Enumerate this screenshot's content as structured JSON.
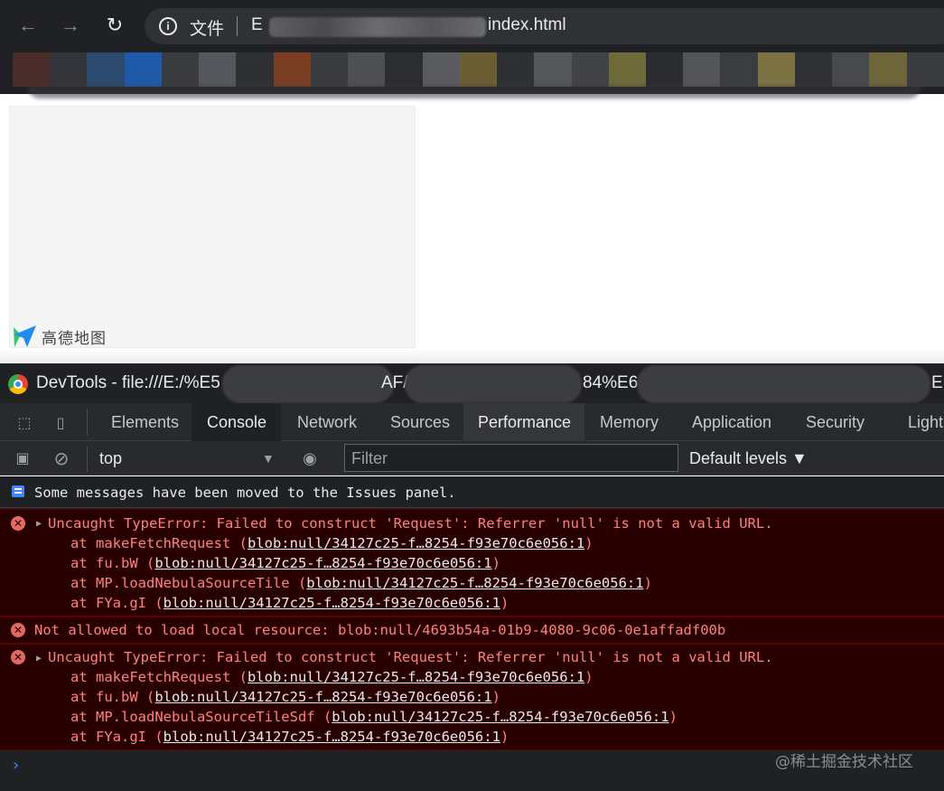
{
  "browser": {
    "back_icon": "←",
    "forward_icon": "→",
    "reload_icon": "↻",
    "info_icon": "i",
    "scheme_label": "文件",
    "url_prefix": "E",
    "url_suffix": "index.html",
    "bookmark_colors": [
      "#4a2c2a",
      "#34353a",
      "#2c4a6e",
      "#1f5aa8",
      "#3a3b3f",
      "#55575c",
      "#2f3033",
      "#7a3e22",
      "#3a3b3e",
      "#4f5053",
      "#2c2d30",
      "#5a5b5e",
      "#6b5e34",
      "#2f3033",
      "#55565a",
      "#424347",
      "#6e6a3a",
      "#2b2c2f",
      "#545559",
      "#3b3c3f",
      "#7d7243",
      "#303134",
      "#48494c",
      "#6e653a",
      "#3a3b3e"
    ]
  },
  "map": {
    "logo_text": "高德地图"
  },
  "devtools": {
    "title_prefix": "DevTools - file:///E:/%E5",
    "title_frag_1": "AF/",
    "title_frag_2": "84%E6",
    "title_frag_3": "E",
    "inspect_icon": "⬚",
    "device_icon": "▯",
    "tabs": {
      "elements": "Elements",
      "console": "Console",
      "network": "Network",
      "sources": "Sources",
      "performance": "Performance",
      "memory": "Memory",
      "application": "Application",
      "security": "Security",
      "lighthouse": "Light"
    },
    "toolbar": {
      "sidebar_icon": "▣",
      "clear_icon": "⊘",
      "context": "top",
      "context_arrow": "▼",
      "eye_icon": "◉",
      "filter_placeholder": "Filter",
      "levels": "Default levels ▼"
    }
  },
  "console": {
    "info_message": "Some messages have been moved to the Issues panel.",
    "error_icon": "✕",
    "error1": {
      "head": "Uncaught TypeError: Failed to construct 'Request': Referrer 'null' is not a valid URL.",
      "frames": [
        {
          "fn": "at makeFetchRequest (",
          "loc": "blob:null/34127c25-f…8254-f93e70c6e056:1",
          "end": ")"
        },
        {
          "fn": "at fu.bW (",
          "loc": "blob:null/34127c25-f…8254-f93e70c6e056:1",
          "end": ")"
        },
        {
          "fn": "at MP.loadNebulaSourceTile (",
          "loc": "blob:null/34127c25-f…8254-f93e70c6e056:1",
          "end": ")"
        },
        {
          "fn": "at FYa.gI (",
          "loc": "blob:null/34127c25-f…8254-f93e70c6e056:1",
          "end": ")"
        }
      ]
    },
    "error2": "Not allowed to load local resource: blob:null/4693b54a-01b9-4080-9c06-0e1affadf00b",
    "error3": {
      "head": "Uncaught TypeError: Failed to construct 'Request': Referrer 'null' is not a valid URL.",
      "frames": [
        {
          "fn": "at makeFetchRequest (",
          "loc": "blob:null/34127c25-f…8254-f93e70c6e056:1",
          "end": ")"
        },
        {
          "fn": "at fu.bW (",
          "loc": "blob:null/34127c25-f…8254-f93e70c6e056:1",
          "end": ")"
        },
        {
          "fn": "at MP.loadNebulaSourceTileSdf (",
          "loc": "blob:null/34127c25-f…8254-f93e70c6e056:1",
          "end": ")"
        },
        {
          "fn": "at FYa.gI (",
          "loc": "blob:null/34127c25-f…8254-f93e70c6e056:1",
          "end": ")"
        }
      ]
    },
    "prompt": "›"
  },
  "watermark": "@稀土掘金技术社区"
}
